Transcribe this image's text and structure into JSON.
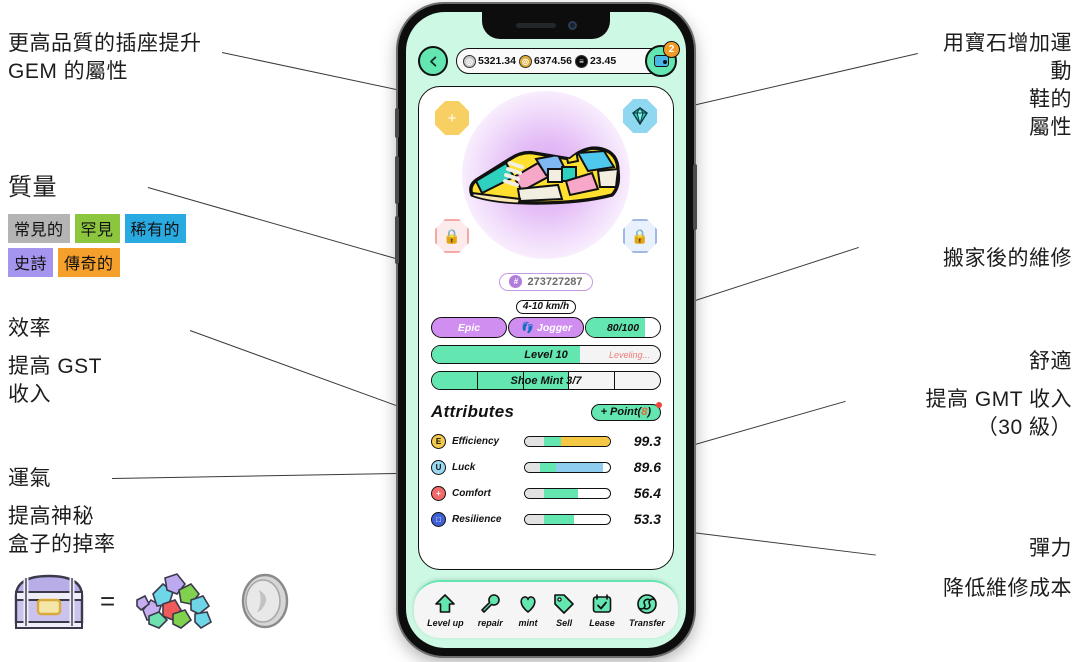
{
  "annotations": {
    "top_left": {
      "line1": "更高品質的插座提升",
      "line2": "GEM 的屬性"
    },
    "quality": {
      "title": "質量",
      "tiers": [
        {
          "label": "常見的",
          "color": "#b4b4b4"
        },
        {
          "label": "罕見",
          "color": "#8cc63e"
        },
        {
          "label": "稀有的",
          "color": "#29abe2"
        },
        {
          "label": "史詩",
          "color": "#a695ee"
        },
        {
          "label": "傳奇的",
          "color": "#f6a02c"
        }
      ]
    },
    "efficiency": {
      "title": "效率",
      "line1": "提高 GST",
      "line2": "收入"
    },
    "luck": {
      "title": "運氣",
      "line1": "提高神秘",
      "line2": "盒子的掉率",
      "equals": "="
    },
    "top_right": {
      "line1": "用寶石增加運",
      "line2": "動",
      "line3": "鞋的",
      "line4": "屬性"
    },
    "repair": {
      "title": "搬家後的維修"
    },
    "comfort": {
      "title": "舒適",
      "line1": "提高 GMT 收入",
      "line2": "（30 級）"
    },
    "resilience": {
      "title": "彈力",
      "line1": "降低維修成本"
    }
  },
  "phone": {
    "topbar": {
      "back_icon": "chevron-left-icon",
      "currencies": [
        {
          "icon": "gst-token-icon",
          "value": "5321.34"
        },
        {
          "icon": "gmt-token-icon",
          "value": "6374.56"
        },
        {
          "icon": "sol-token-icon",
          "value": "23.45"
        }
      ],
      "wallet_icon": "wallet-icon",
      "wallet_badge": "2"
    },
    "sockets": [
      {
        "name": "socket-add",
        "glyph": "+",
        "state": "empty"
      },
      {
        "name": "socket-gem",
        "glyph": "◆",
        "state": "filled"
      },
      {
        "name": "socket-lock-left",
        "glyph": "🔒",
        "state": "locked"
      },
      {
        "name": "socket-lock-right",
        "glyph": "🔒",
        "state": "locked"
      }
    ],
    "shoe_id": "273727287",
    "rarity": "Epic",
    "speed": "4-10 km/h",
    "shoe_type": "Jogger",
    "durability": {
      "text": "80/100",
      "percent": 80
    },
    "level": {
      "text": "Level 10",
      "status": "Leveling...",
      "percent": 65
    },
    "mint": {
      "text": "Shoe Mint 3/7",
      "segments": 5,
      "filled": 3
    },
    "attributes": {
      "title": "Attributes",
      "point_label": "+ Point(",
      "point_value": "8",
      "point_close": ")",
      "rows": [
        {
          "name": "efficiency",
          "icon_letter": "E",
          "icon_color": "#f2c94c",
          "label": "Efficiency",
          "value": "99.3",
          "base": 22,
          "mid": 20,
          "ext": 58,
          "ext_color": "#f4c744"
        },
        {
          "name": "luck",
          "icon_letter": "U",
          "icon_color": "#9ad9f2",
          "label": "Luck",
          "value": "89.6",
          "base": 18,
          "mid": 19,
          "ext": 55,
          "ext_color": "#8ecdf0"
        },
        {
          "name": "comfort",
          "icon_letter": "+",
          "icon_color": "#f26a6a",
          "label": "Comfort",
          "value": "56.4",
          "base": 22,
          "mid": 40,
          "ext": 0,
          "ext_color": "#ffffff"
        },
        {
          "name": "resilience",
          "icon_letter": "□",
          "icon_color": "#3f5fd4",
          "label": "Resilience",
          "value": "53.3",
          "base": 22,
          "mid": 36,
          "ext": 0,
          "ext_color": "#ffffff"
        }
      ]
    },
    "nav": [
      {
        "icon": "arrow-up-icon",
        "label": "Level up"
      },
      {
        "icon": "wrench-icon",
        "label": "repair"
      },
      {
        "icon": "heart-icon",
        "label": "mint"
      },
      {
        "icon": "tag-icon",
        "label": "Sell"
      },
      {
        "icon": "calendar-icon",
        "label": "Lease"
      },
      {
        "icon": "transfer-icon",
        "label": "Transfer"
      }
    ]
  },
  "colors": {
    "mint": "#63e6b0",
    "screen_bg": "#ccf8e4",
    "purple": "#cf8ef0",
    "gold": "#f4c744"
  }
}
